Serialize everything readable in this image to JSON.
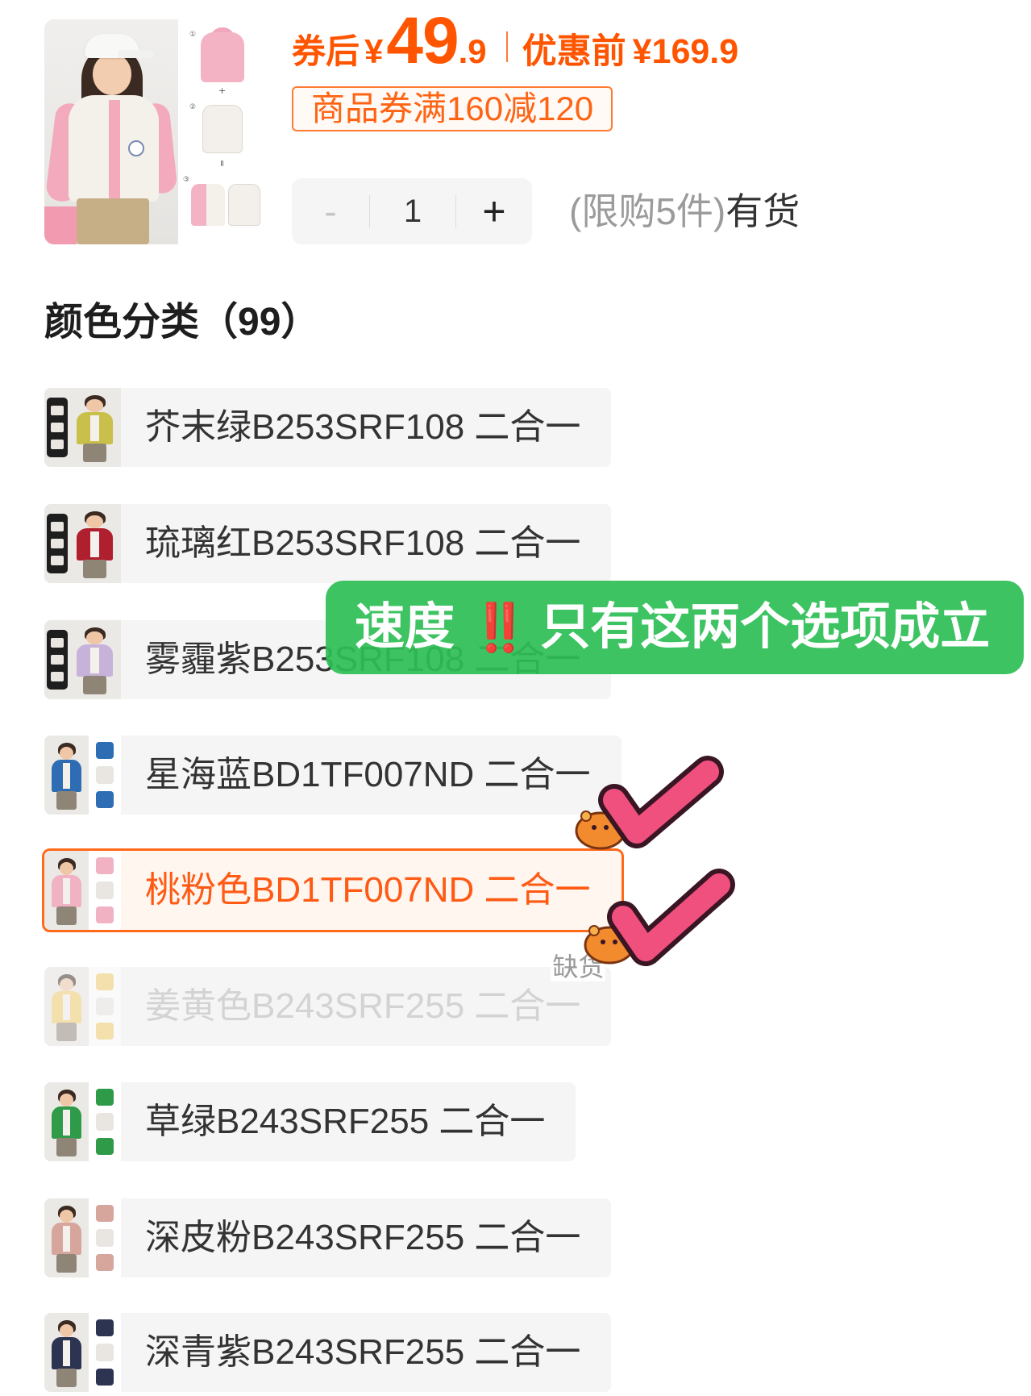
{
  "product": {
    "thumbnail": {
      "markers": [
        "①",
        "②",
        "③"
      ],
      "plus": "+",
      "equals": "="
    },
    "price": {
      "label": "券后",
      "currency": "¥",
      "integer": "49",
      "decimal": ".9"
    },
    "original_price": {
      "label": "优惠前",
      "value": "¥169.9"
    },
    "coupon": "商品券满160减120",
    "quantity": {
      "minus": "-",
      "value": "1",
      "plus": "+"
    },
    "purchase_limit": "(限购5件)",
    "stock_status": "有货",
    "colors": {
      "price": "#ff5500",
      "selected_border": "#ff6a1a"
    }
  },
  "variants": {
    "title": "颜色分类（99）",
    "items": [
      {
        "label": "芥末绿B253SRF108 二合一",
        "color": "#c8c04a"
      },
      {
        "label": "琉璃红B253SRF108 二合一",
        "color": "#b01f2e"
      },
      {
        "label": "雾霾紫B253SRF108 二合一",
        "color": "#c7b3d9"
      },
      {
        "label": "星海蓝BD1TF007ND 二合一",
        "color": "#2e6db3"
      },
      {
        "label": "桃粉色BD1TF007ND 二合一",
        "color": "#f1b3c3",
        "selected": true
      },
      {
        "label": "姜黄色B243SRF255 二合一",
        "color": "#f3cd67",
        "badge": "缺货",
        "available": false
      },
      {
        "label": "草绿B243SRF255 二合一",
        "color": "#2f9a48"
      },
      {
        "label": "深皮粉B243SRF255 二合一",
        "color": "#d6a69c"
      },
      {
        "label": "深青紫B243SRF255 二合一",
        "color": "#2d3452"
      }
    ]
  },
  "annotation": {
    "prefix": "速度",
    "emoji": "‼️",
    "text": "只有这两个选项成立",
    "color": "#2ebe56",
    "check_color": "#f0507e"
  }
}
